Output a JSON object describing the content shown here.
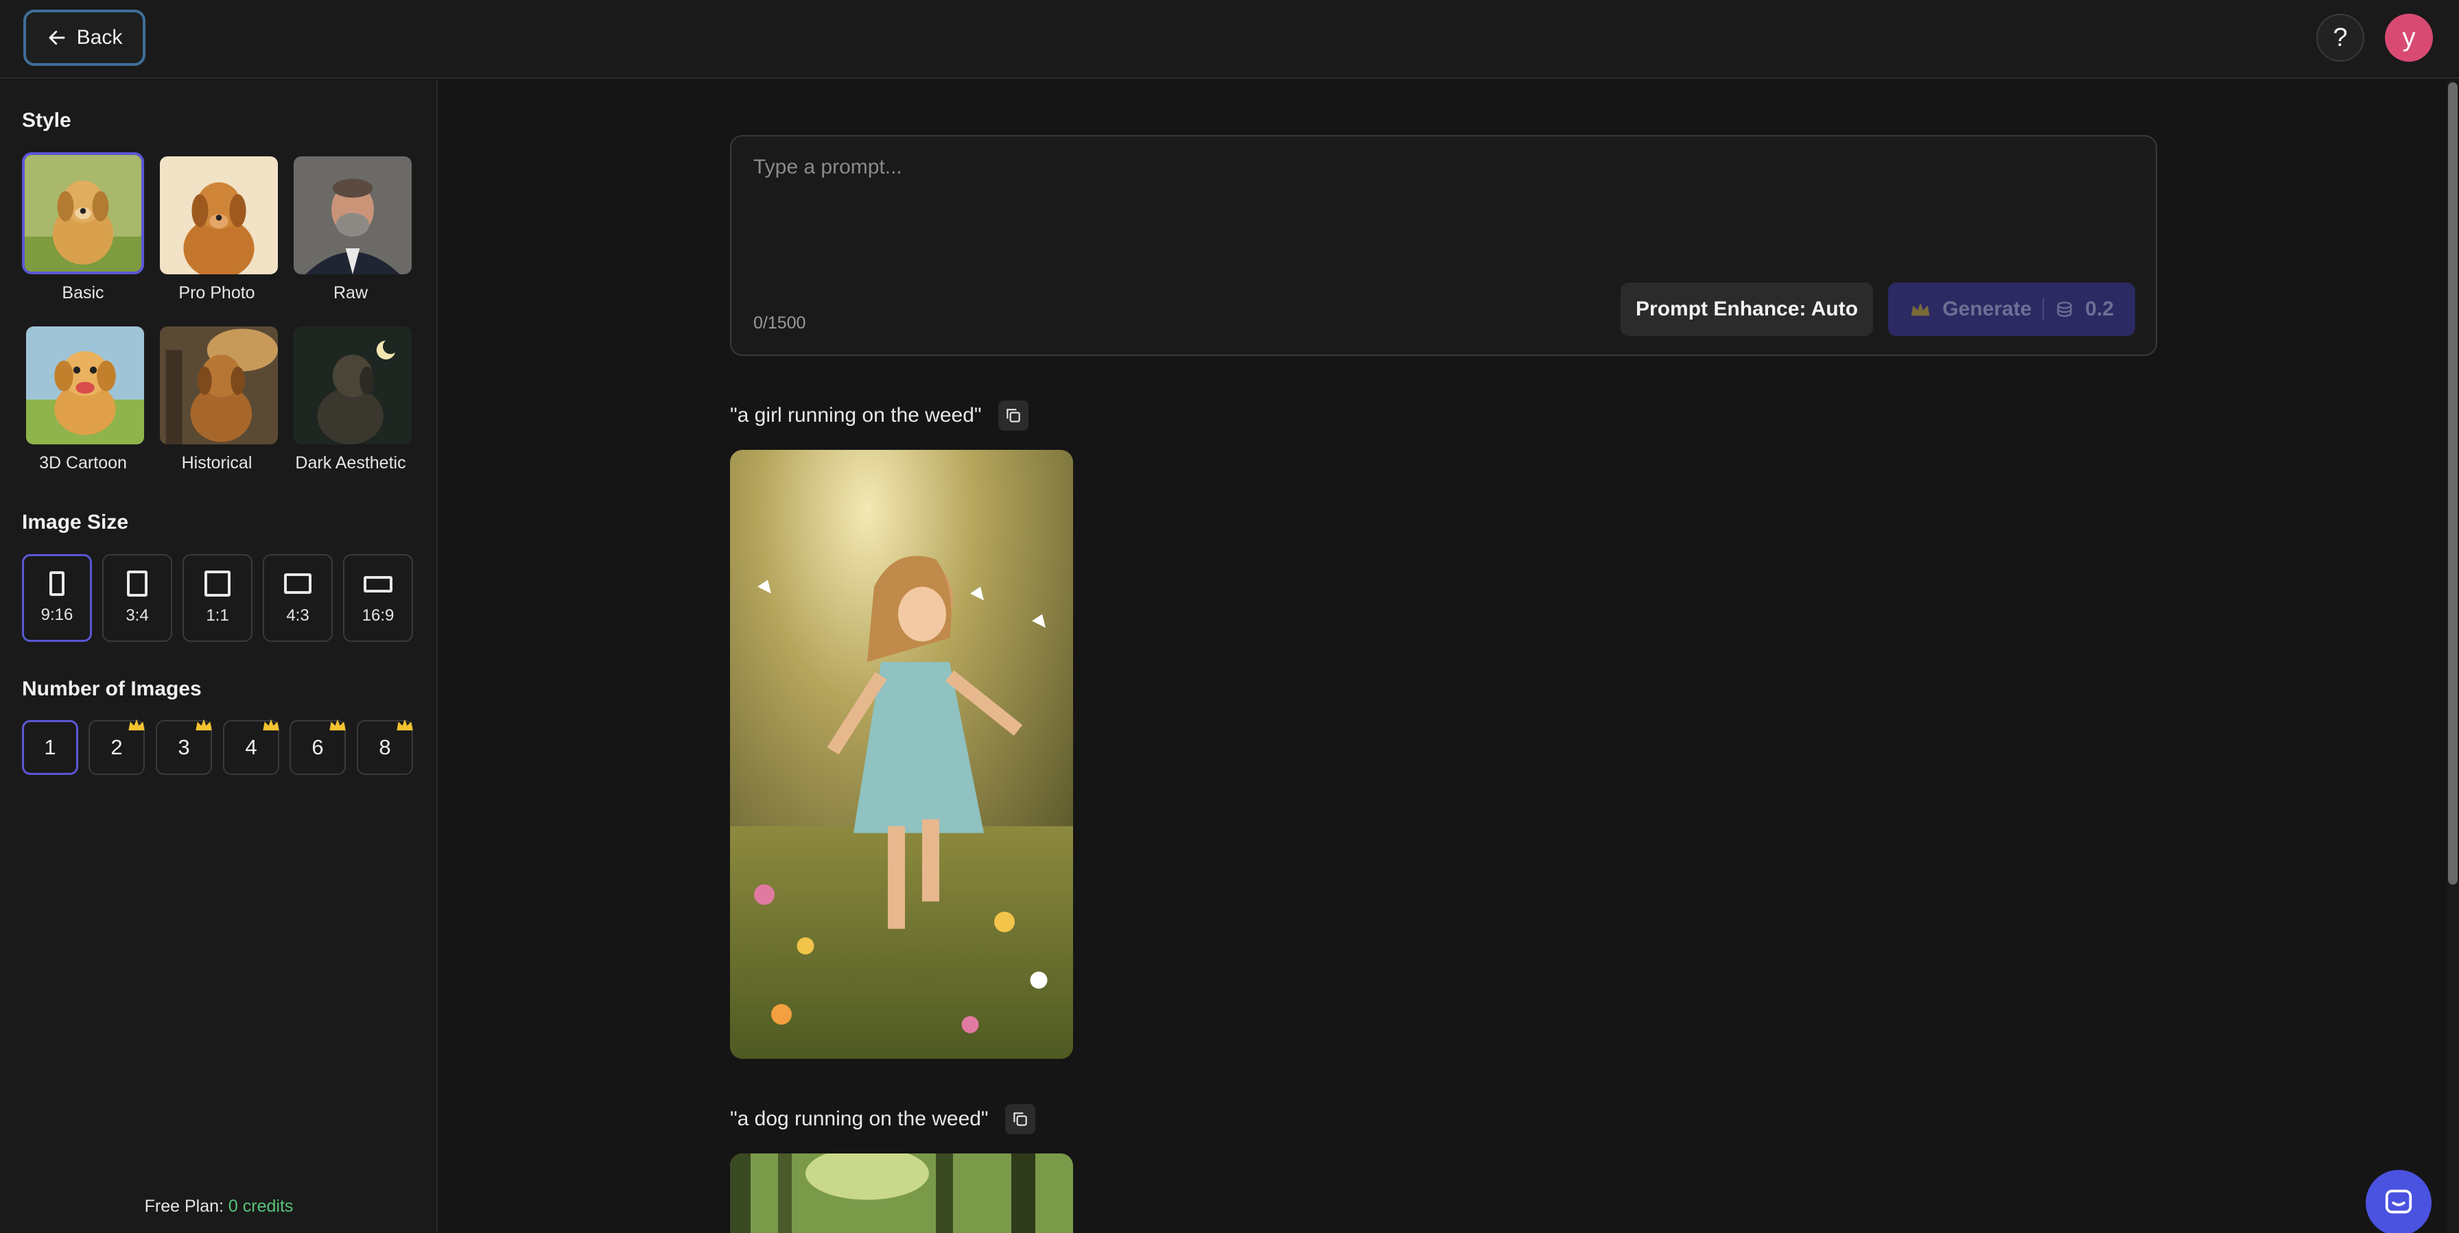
{
  "topbar": {
    "back_label": "Back",
    "help_label": "?",
    "avatar_initial": "y"
  },
  "sidebar": {
    "style_title": "Style",
    "styles": [
      {
        "label": "Basic",
        "selected": true
      },
      {
        "label": "Pro Photo",
        "selected": false
      },
      {
        "label": "Raw",
        "selected": false
      },
      {
        "label": "3D Cartoon",
        "selected": false
      },
      {
        "label": "Historical",
        "selected": false
      },
      {
        "label": "Dark Aesthetic",
        "selected": false
      }
    ],
    "size_title": "Image Size",
    "sizes": [
      {
        "label": "9:16",
        "selected": true
      },
      {
        "label": "3:4",
        "selected": false
      },
      {
        "label": "1:1",
        "selected": false
      },
      {
        "label": "4:3",
        "selected": false
      },
      {
        "label": "16:9",
        "selected": false
      }
    ],
    "count_title": "Number of Images",
    "counts": [
      {
        "label": "1",
        "selected": true,
        "premium": false
      },
      {
        "label": "2",
        "selected": false,
        "premium": true
      },
      {
        "label": "3",
        "selected": false,
        "premium": true
      },
      {
        "label": "4",
        "selected": false,
        "premium": true
      },
      {
        "label": "6",
        "selected": false,
        "premium": true
      },
      {
        "label": "8",
        "selected": false,
        "premium": true
      }
    ],
    "plan_label": "Free Plan:",
    "plan_credits": "0 credits"
  },
  "prompt": {
    "value": "",
    "placeholder": "Type a prompt...",
    "char_count": "0/1500",
    "enhance_label": "Prompt Enhance: Auto",
    "generate_label": "Generate",
    "generate_cost": "0.2"
  },
  "history": [
    {
      "prompt": "\"a girl running on the weed\""
    },
    {
      "prompt": "\"a dog running on the weed\""
    }
  ],
  "colors": {
    "accent": "#5b57d6",
    "credits": "#58c47a",
    "avatar": "#d84a72",
    "generate_bg": "#2c2a63"
  }
}
